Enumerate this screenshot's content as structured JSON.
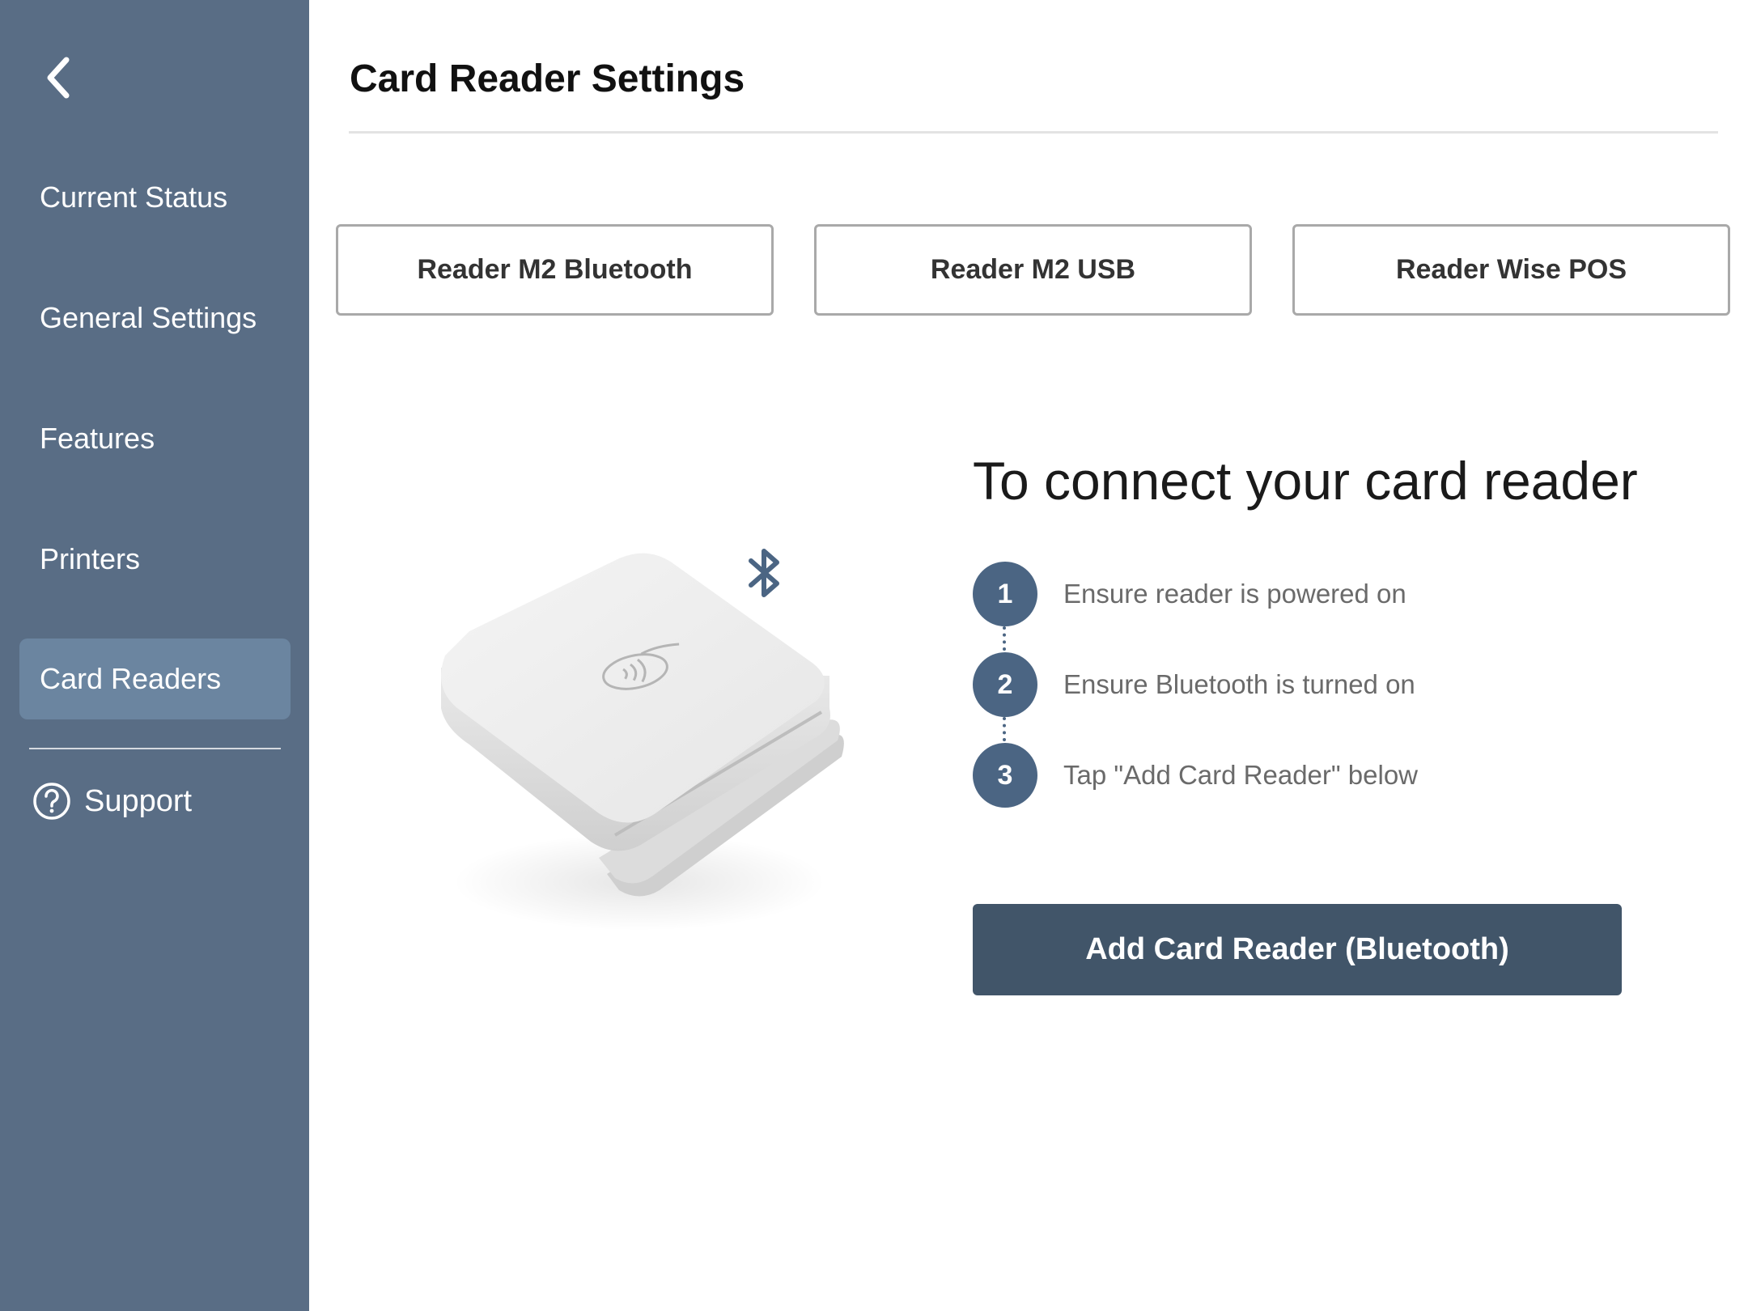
{
  "sidebar": {
    "back_icon": "chevron-left-icon",
    "items": [
      {
        "label": "Current Status",
        "active": false
      },
      {
        "label": "General Settings",
        "active": false
      },
      {
        "label": "Features",
        "active": false
      },
      {
        "label": "Printers",
        "active": false
      },
      {
        "label": "Card Readers",
        "active": true
      }
    ],
    "support": {
      "label": "Support",
      "icon": "help-circle-icon"
    }
  },
  "header": {
    "title": "Card Reader Settings"
  },
  "reader_tabs": [
    {
      "label": "Reader M2 Bluetooth"
    },
    {
      "label": "Reader M2 USB"
    },
    {
      "label": "Reader Wise POS"
    }
  ],
  "illustration": {
    "device_icon": "card-reader-device",
    "bluetooth_icon": "bluetooth-icon"
  },
  "instructions": {
    "heading": "To connect your card reader",
    "steps": [
      {
        "number": "1",
        "text": "Ensure reader is powered on"
      },
      {
        "number": "2",
        "text": "Ensure Bluetooth is turned on"
      },
      {
        "number": "3",
        "text": "Tap \"Add Card Reader\" below"
      }
    ]
  },
  "actions": {
    "add_label": "Add Card Reader (Bluetooth)"
  },
  "colors": {
    "sidebar_bg": "#596d85",
    "sidebar_active": "#6b85a0",
    "step_circle": "#4b6583",
    "primary_button": "#415569"
  }
}
